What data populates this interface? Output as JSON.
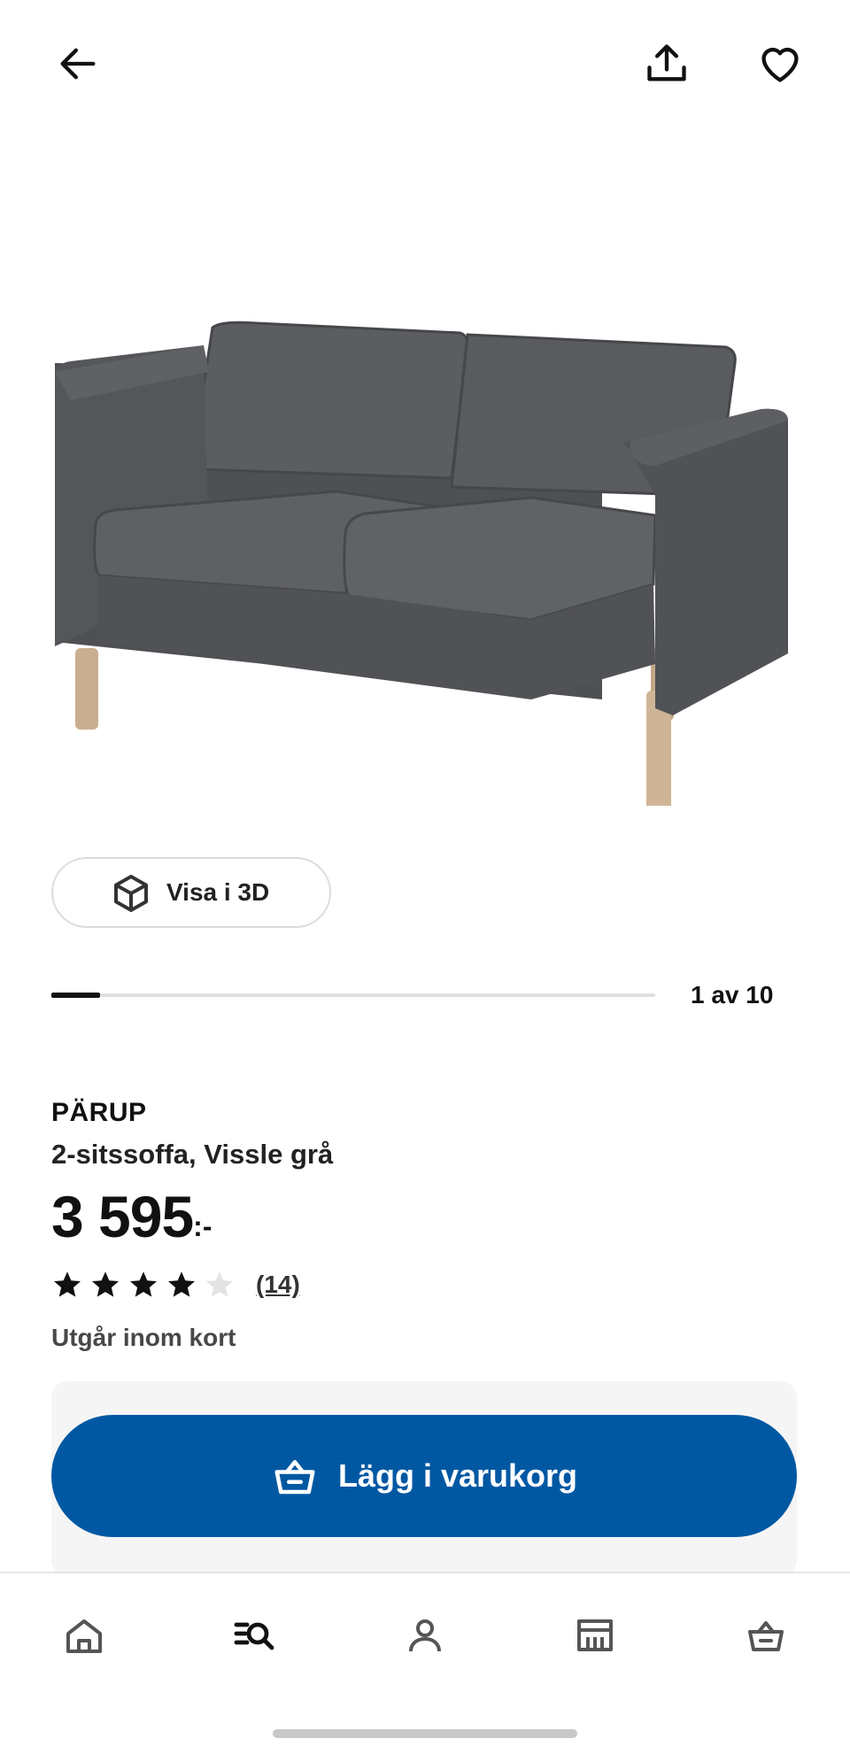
{
  "header": {
    "back_icon": "arrow-left-icon",
    "share_icon": "share-icon",
    "favorite_icon": "heart-icon"
  },
  "gallery": {
    "view_3d_label": "Visa i 3D",
    "view_3d_icon": "cube-icon",
    "image_position": "1 av 10",
    "current_image": 1,
    "total_images": 10
  },
  "product": {
    "brand": "PÄRUP",
    "description": "2-sitssoffa, Vissle grå",
    "price": "3 595",
    "price_suffix": ":-",
    "rating": 4,
    "rating_max": 5,
    "reviews": "(14)",
    "availability": "Utgår inom kort"
  },
  "actions": {
    "add_to_cart_label": "Lägg i varukorg",
    "cart_icon": "basket-icon",
    "button_color": "#0058a3"
  },
  "bottom_nav": {
    "items": [
      {
        "icon": "home-icon"
      },
      {
        "icon": "search-icon"
      },
      {
        "icon": "profile-icon"
      },
      {
        "icon": "store-icon"
      },
      {
        "icon": "basket-icon"
      }
    ]
  }
}
